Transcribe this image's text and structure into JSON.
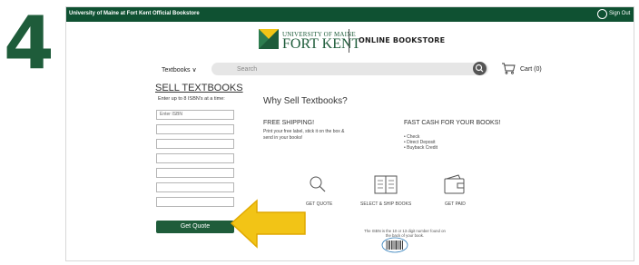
{
  "step_number": "4",
  "topbar": {
    "title": "University of Maine at Fort Kent Official Bookstore",
    "signout_label": "Sign Out"
  },
  "header": {
    "logo_line1": "UNIVERSITY OF MAINE",
    "logo_line2": "FORT KENT",
    "store_name": "ONLINE BOOKSTORE"
  },
  "nav": {
    "textbooks_label": "Textbooks ∨",
    "search_placeholder": "Search",
    "cart_label": "Cart (0)"
  },
  "sell_panel": {
    "heading": "SELL TEXTBOOKS",
    "subtext": "Enter up to 8 ISBN's at a time:",
    "first_placeholder": "Enter ISBN",
    "button_label": "Get Quote"
  },
  "why": {
    "heading": "Why Sell Textbooks?",
    "shipping_title": "FREE SHIPPING!",
    "shipping_text": "Print your free label, stick it on the box & send in your books!",
    "cash_title": "FAST CASH FOR YOUR BOOKS!",
    "cash_options": [
      "Check",
      "Direct Deposit",
      "Buyback Credit"
    ]
  },
  "features": [
    {
      "label": "GET QUOTE",
      "icon": "magnifier-icon"
    },
    {
      "label": "SELECT & SHIP BOOKS",
      "icon": "book-icon"
    },
    {
      "label": "GET PAID",
      "icon": "wallet-icon"
    }
  ],
  "isbn_note": "The ISBN is the 10 or 13 digit number found on the back of your book.",
  "colors": {
    "brand_green": "#0f5132",
    "button_green": "#1e5c3a",
    "arrow_yellow": "#f2c416"
  }
}
